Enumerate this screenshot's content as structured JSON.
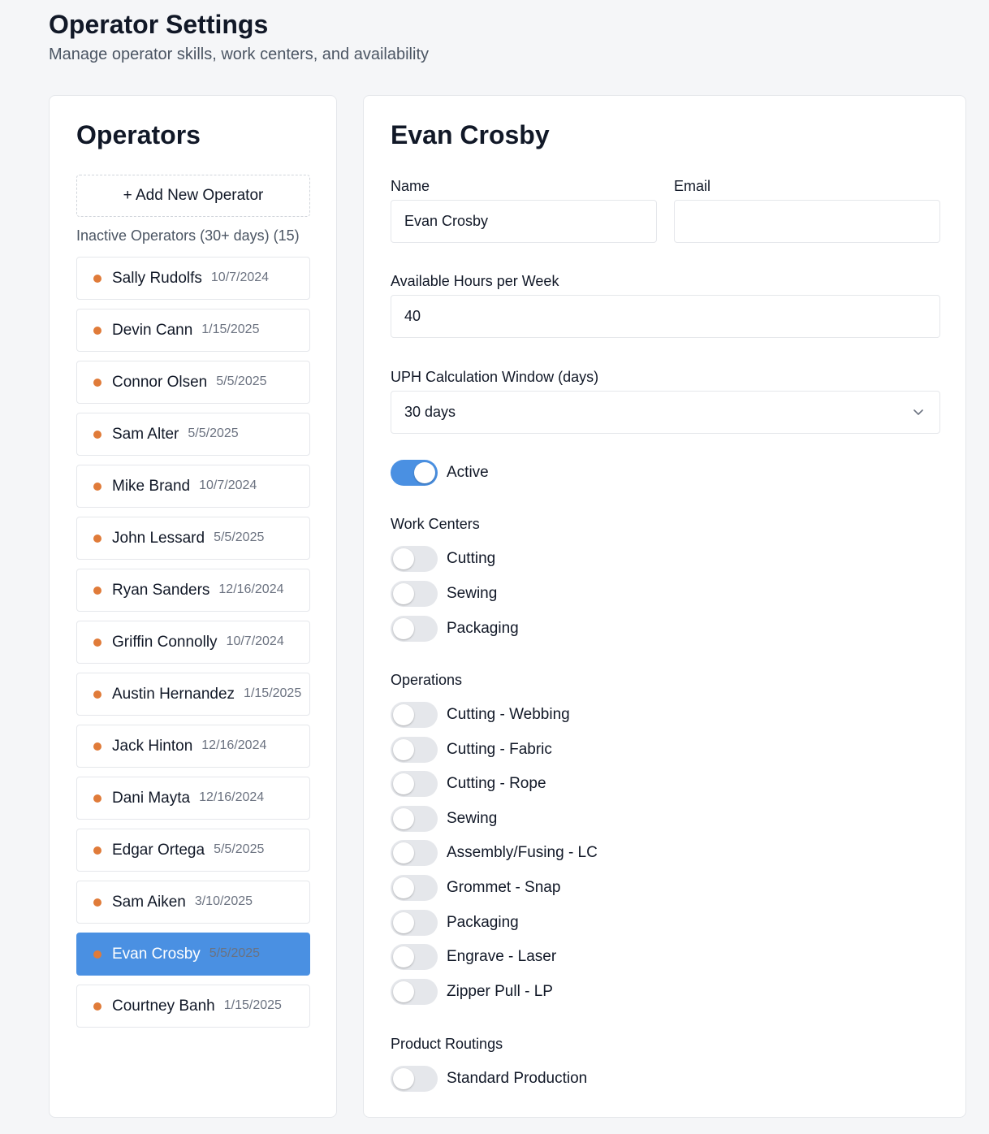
{
  "header": {
    "title": "Operator Settings",
    "subtitle": "Manage operator skills, work centers, and availability"
  },
  "sidebar": {
    "title": "Operators",
    "add_label": "+ Add New Operator",
    "inactive_label": "Inactive Operators (30+ days) (15)",
    "status_color": "#e07b39",
    "selected_color": "#4a90e2",
    "operators": [
      {
        "name": "Sally Rudolfs",
        "date": "10/7/2024"
      },
      {
        "name": "Devin Cann",
        "date": "1/15/2025"
      },
      {
        "name": "Connor Olsen",
        "date": "5/5/2025"
      },
      {
        "name": "Sam Alter",
        "date": "5/5/2025"
      },
      {
        "name": "Mike Brand",
        "date": "10/7/2024"
      },
      {
        "name": "John Lessard",
        "date": "5/5/2025"
      },
      {
        "name": "Ryan Sanders",
        "date": "12/16/2024"
      },
      {
        "name": "Griffin Connolly",
        "date": "10/7/2024"
      },
      {
        "name": "Austin Hernandez",
        "date": "1/15/2025"
      },
      {
        "name": "Jack Hinton",
        "date": "12/16/2024"
      },
      {
        "name": "Dani Mayta",
        "date": "12/16/2024"
      },
      {
        "name": "Edgar Ortega",
        "date": "5/5/2025"
      },
      {
        "name": "Sam Aiken",
        "date": "3/10/2025"
      },
      {
        "name": "Evan Crosby",
        "date": "5/5/2025",
        "selected": true
      },
      {
        "name": "Courtney Banh",
        "date": "1/15/2025"
      }
    ]
  },
  "detail": {
    "title": "Evan Crosby",
    "name_label": "Name",
    "name_value": "Evan Crosby",
    "email_label": "Email",
    "email_value": "",
    "hours_label": "Available Hours per Week",
    "hours_value": "40",
    "uph_label": "UPH Calculation Window (days)",
    "uph_value": "30 days",
    "active_label": "Active",
    "active": true,
    "work_centers_label": "Work Centers",
    "work_centers": [
      {
        "label": "Cutting",
        "on": false
      },
      {
        "label": "Sewing",
        "on": false
      },
      {
        "label": "Packaging",
        "on": false
      }
    ],
    "operations_label": "Operations",
    "operations": [
      {
        "label": "Cutting - Webbing",
        "on": false
      },
      {
        "label": "Cutting - Fabric",
        "on": false
      },
      {
        "label": "Cutting - Rope",
        "on": false
      },
      {
        "label": "Sewing",
        "on": false
      },
      {
        "label": "Assembly/Fusing - LC",
        "on": false
      },
      {
        "label": "Grommet - Snap",
        "on": false
      },
      {
        "label": "Packaging",
        "on": false
      },
      {
        "label": "Engrave - Laser",
        "on": false
      },
      {
        "label": "Zipper Pull - LP",
        "on": false
      }
    ],
    "routings_label": "Product Routings",
    "routings": [
      {
        "label": "Standard Production",
        "on": false
      }
    ]
  }
}
